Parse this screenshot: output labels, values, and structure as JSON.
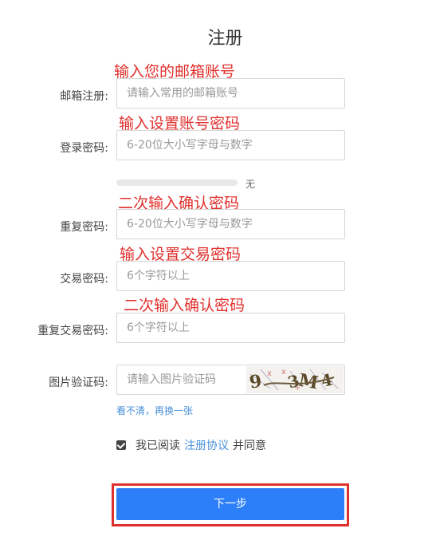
{
  "page": {
    "title": "注册"
  },
  "annotations": {
    "email": "输入您的邮箱账号",
    "password": "输入设置账号密码",
    "confirm_password": "二次输入确认密码",
    "trade_password": "输入设置交易密码",
    "confirm_trade_password": "二次输入确认密码"
  },
  "form": {
    "email": {
      "label": "邮箱注册:",
      "placeholder": "请输入常用的邮箱账号"
    },
    "password": {
      "label": "登录密码:",
      "placeholder": "6-20位大小写字母与数字"
    },
    "strength": {
      "text": "无"
    },
    "confirm_password": {
      "label": "重复密码:",
      "placeholder": "6-20位大小写字母与数字"
    },
    "trade_password": {
      "label": "交易密码:",
      "placeholder": "6个字符以上"
    },
    "confirm_trade_password": {
      "label": "重复交易密码:",
      "placeholder": "6个字符以上"
    },
    "captcha": {
      "label": "图片验证码:",
      "placeholder": "请输入图片验证码",
      "refresh_link": "看不清，再换一张"
    }
  },
  "agreement": {
    "prefix": "我已阅读",
    "link": "注册协议",
    "suffix": "并同意",
    "checked": true
  },
  "submit": {
    "label": "下一步"
  },
  "colors": {
    "accent": "#2d7ff9",
    "annotation": "#e0302d",
    "link": "#4a90d9"
  }
}
